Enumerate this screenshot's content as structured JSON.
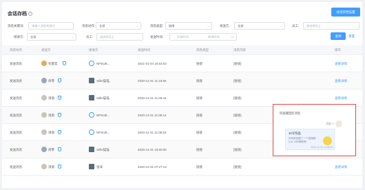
{
  "page": {
    "title": "会话存档",
    "settings_button": "会话存档设置"
  },
  "filters": {
    "keyword": {
      "label": "消息关键词:",
      "placeholder": "请输入消息关键词"
    },
    "msg_action": {
      "label": "消息动作:",
      "value": "全部"
    },
    "msg_type": {
      "label": "消息类型:",
      "value": "链接"
    },
    "sender": {
      "label": "发送方:",
      "value": "全部"
    },
    "employee": {
      "label": "员工:",
      "placeholder": "请选择员工"
    },
    "receiver": {
      "label": "接收方:",
      "value": "全部"
    },
    "employee2": {
      "label": "员工:",
      "placeholder": "请选择员工"
    },
    "send_time": {
      "label": "发送时间:",
      "start_placeholder": "开始时间",
      "separator": "-",
      "end_placeholder": "结束时间"
    },
    "query_button": "查询",
    "reset_button": "重置"
  },
  "table": {
    "headers": [
      "消息动作",
      "发送方",
      "接收方",
      "发送时间",
      "消息类型",
      "消息内容",
      "操作"
    ],
    "rows": [
      {
        "action": "发送消息",
        "sender": "有量官",
        "receiver": "NPSUB...",
        "time": "2021-01-04 16:53:03",
        "type": "链接",
        "content": "[链接]",
        "op": "查看详情"
      },
      {
        "action": "发送消息",
        "sender": "商零",
        "receiver": "Stille猫猫",
        "time": "2020-12-31 11:18:56",
        "type": "链接",
        "content": "[链接]",
        "op": "查看详情"
      },
      {
        "action": "发送消息",
        "sender": "须丽",
        "receiver": "Stille猫猫",
        "time": "2020-12-31 11:09:44",
        "type": "链接",
        "content": "[链接]",
        "op": "查看详情"
      },
      {
        "action": "发送消息",
        "sender": "须丽",
        "receiver": "NPSUB...",
        "time": "2020-12-31 11:09:14",
        "type": "链接",
        "content": "[链接]",
        "op": "查看详情"
      },
      {
        "action": "发送消息",
        "sender": "须丽",
        "receiver": "NPSUB...",
        "time": "2020-12-31 11:08:54",
        "type": "链接",
        "content": "[链接]",
        "op": "查看详情"
      },
      {
        "action": "发送消息",
        "sender": "商零",
        "receiver": "Stille猫猫",
        "time": "2020-12-31 10:50:06",
        "type": "链接",
        "content": "[链接]",
        "op": "查看详情"
      },
      {
        "action": "发送消息",
        "sender": "须丽",
        "receiver": "张泽",
        "time": "2020-12-31 07:27:14",
        "type": "链接",
        "content": "[链接]",
        "op": "查看详情"
      }
    ]
  },
  "popup": {
    "title": "快速撤回的消息",
    "sender": "须丽 八",
    "card_title": "31号作品",
    "card_desc": "你有新回复了一个链接图片(1,3)你看看吧!",
    "card_time": "2020-12-31 11:09:44"
  }
}
